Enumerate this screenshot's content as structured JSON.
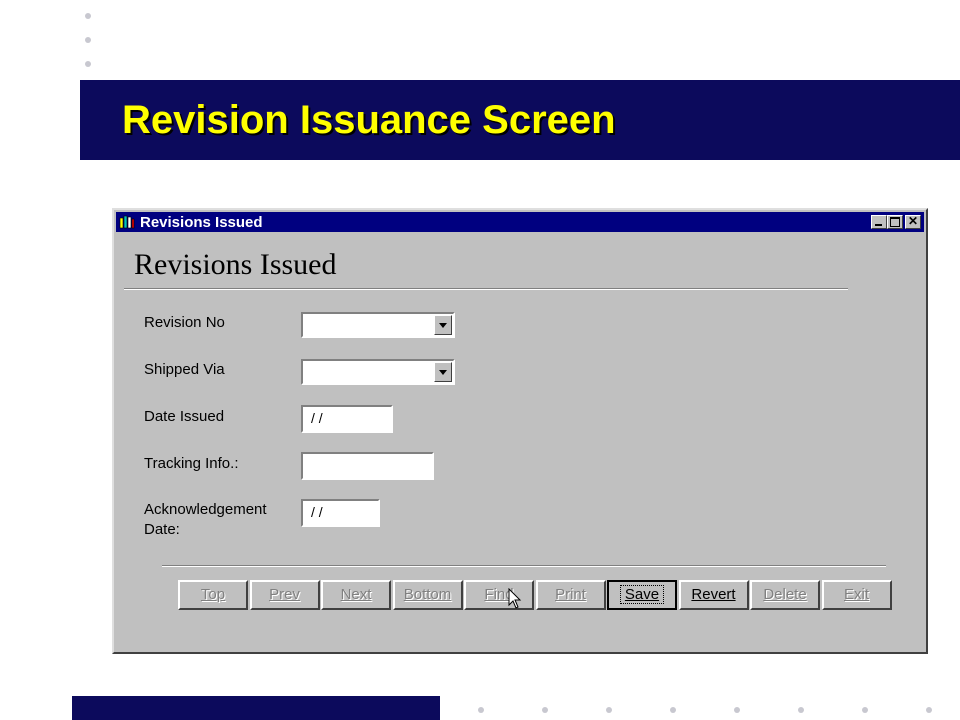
{
  "slide": {
    "title": "Revision Issuance Screen",
    "colors": {
      "band": "#0c0a5c",
      "title": "#ffff00"
    }
  },
  "window": {
    "title": "Revisions Issued",
    "icon": "books-icon",
    "controls": [
      "minimize-icon",
      "maximize-icon",
      "close-icon"
    ],
    "close_glyph": "✕"
  },
  "form": {
    "heading": "Revisions Issued",
    "fields": {
      "revision_no": {
        "label": "Revision No",
        "value": ""
      },
      "shipped_via": {
        "label": "Shipped Via",
        "value": ""
      },
      "date_issued": {
        "label": "Date Issued",
        "value": "/ /"
      },
      "tracking_info": {
        "label": "Tracking Info.:",
        "value": ""
      },
      "ack_date": {
        "label": "Acknowledgement Date:",
        "value": "/ /"
      }
    }
  },
  "buttons": {
    "top": {
      "label": "Top",
      "enabled": false
    },
    "prev": {
      "label": "Prev",
      "enabled": false
    },
    "next": {
      "label": "Next",
      "enabled": false
    },
    "bottom": {
      "label": "Bottom",
      "enabled": false
    },
    "find": {
      "label": "Find",
      "enabled": false
    },
    "print": {
      "label": "Print",
      "enabled": false
    },
    "save": {
      "label": "Save",
      "enabled": true,
      "default": true
    },
    "revert": {
      "label": "Revert",
      "enabled": true
    },
    "delete": {
      "label": "Delete",
      "enabled": false
    },
    "exit": {
      "label": "Exit",
      "enabled": false
    }
  }
}
